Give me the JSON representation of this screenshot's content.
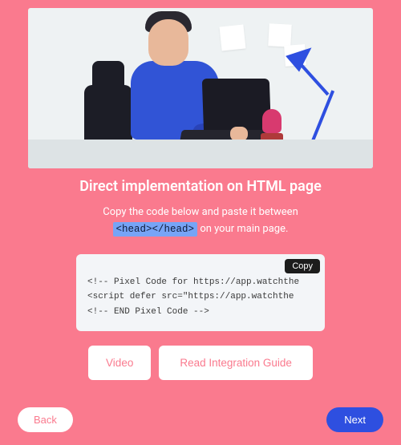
{
  "heading": "Direct implementation on HTML page",
  "subtitle_pre": "Copy the code below and paste it between",
  "subtitle_code": "<head></head>",
  "subtitle_post": "on your main page.",
  "copy_label": "Copy",
  "code_lines": [
    "<!-- Pixel Code for https://app.watchthe",
    "<script defer src=\"https://app.watchthe",
    "<!-- END Pixel Code -->"
  ],
  "buttons": {
    "video": "Video",
    "guide": "Read Integration Guide",
    "back": "Back",
    "next": "Next"
  }
}
